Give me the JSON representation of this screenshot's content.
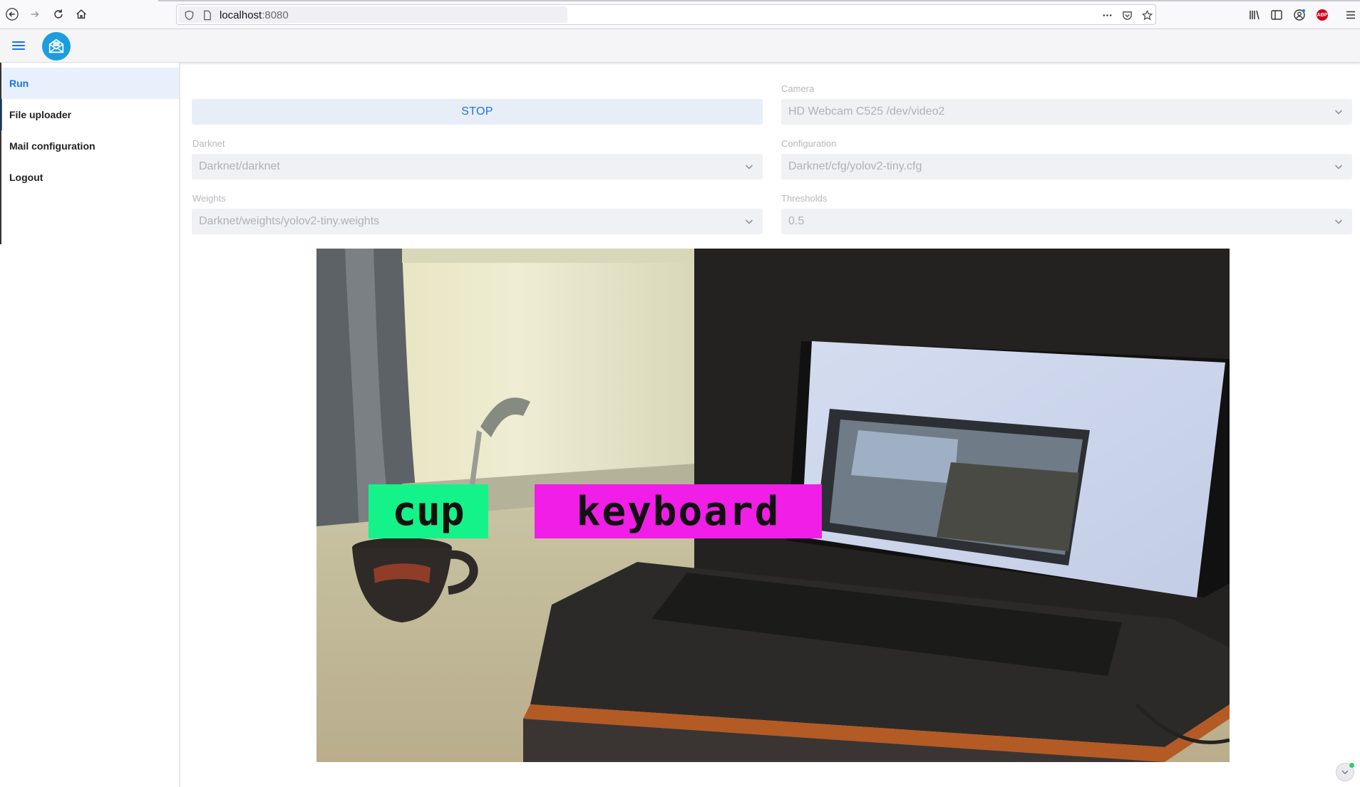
{
  "browser": {
    "url_host": "localhost",
    "url_port": ":8080"
  },
  "sidebar": {
    "items": [
      {
        "label": "Run"
      },
      {
        "label": "File uploader"
      },
      {
        "label": "Mail configuration"
      },
      {
        "label": "Logout"
      }
    ]
  },
  "controls": {
    "stop_label": "STOP",
    "camera": {
      "label": "Camera",
      "value": "HD Webcam C525 /dev/video2"
    },
    "darknet": {
      "label": "Darknet",
      "value": "Darknet/darknet"
    },
    "configuration": {
      "label": "Configuration",
      "value": "Darknet/cfg/yolov2-tiny.cfg"
    },
    "weights": {
      "label": "Weights",
      "value": "Darknet/weights/yolov2-tiny.weights"
    },
    "thresholds": {
      "label": "Thresholds",
      "value": "0.5"
    }
  },
  "detections": [
    {
      "label": "cup",
      "color": "#14f28a"
    },
    {
      "label": "keyboard",
      "color": "#f01ee6"
    }
  ],
  "colors": {
    "accent": "#1a73e8",
    "logo": "#1a9ede"
  }
}
